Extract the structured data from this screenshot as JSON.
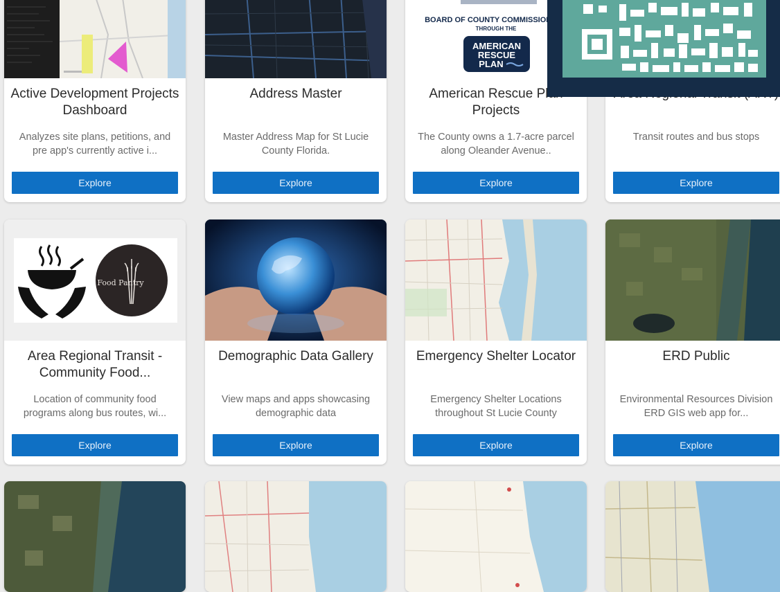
{
  "cards": [
    {
      "title": "Active Development Projects Dashboard",
      "desc": "Analyzes site plans, petitions, and pre app's currently active i...",
      "button": "Explore"
    },
    {
      "title": "Address Master",
      "desc": "Master Address Map for St Lucie County Florida.",
      "button": "Explore"
    },
    {
      "title": "American Rescue Plan Projects",
      "desc": "The County owns a 1.7-acre parcel along Oleander Avenue..",
      "button": "Explore"
    },
    {
      "title": "Area Regional Transit (ART)",
      "desc": "Transit routes and bus stops",
      "button": "Explore"
    },
    {
      "title": "Area Regional Transit - Community Food...",
      "desc": "Location of community food programs along bus routes, wi...",
      "button": "Explore"
    },
    {
      "title": "Demographic Data Gallery",
      "desc": "View maps and apps showcasing demographic data",
      "button": "Explore"
    },
    {
      "title": "Emergency Shelter Locator",
      "desc": "Emergency Shelter Locations throughout St Lucie County",
      "button": "Explore"
    },
    {
      "title": "ERD Public",
      "desc": "Environmental Resources Division ERD GIS web app for...",
      "button": "Explore"
    }
  ],
  "thumb_text": {
    "arp_board": "BOARD OF COUNTY COMMISSIONERS",
    "arp_through": "THROUGH THE",
    "arp_logo_1": "AMERICAN",
    "arp_logo_2": "RESCUE",
    "arp_logo_3": "PLAN",
    "food_pantry": "Food Pantry"
  },
  "colors": {
    "button": "#0f70c4",
    "qr_frame": "#152c47",
    "qr_fill": "#5fa89c"
  }
}
